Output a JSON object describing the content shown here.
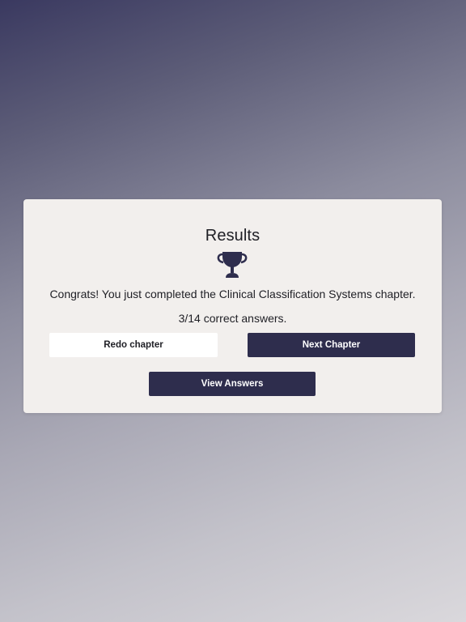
{
  "results": {
    "title": "Results",
    "trophy_icon": "trophy-icon",
    "congrats_message": "Congrats! You just completed the Clinical Classification Systems chapter.",
    "score_text": "3/14 correct answers."
  },
  "actions": {
    "redo_label": "Redo chapter",
    "next_label": "Next Chapter",
    "view_answers_label": "View Answers"
  },
  "colors": {
    "accent": "#2e2d4d",
    "card_background": "#f2efed"
  }
}
